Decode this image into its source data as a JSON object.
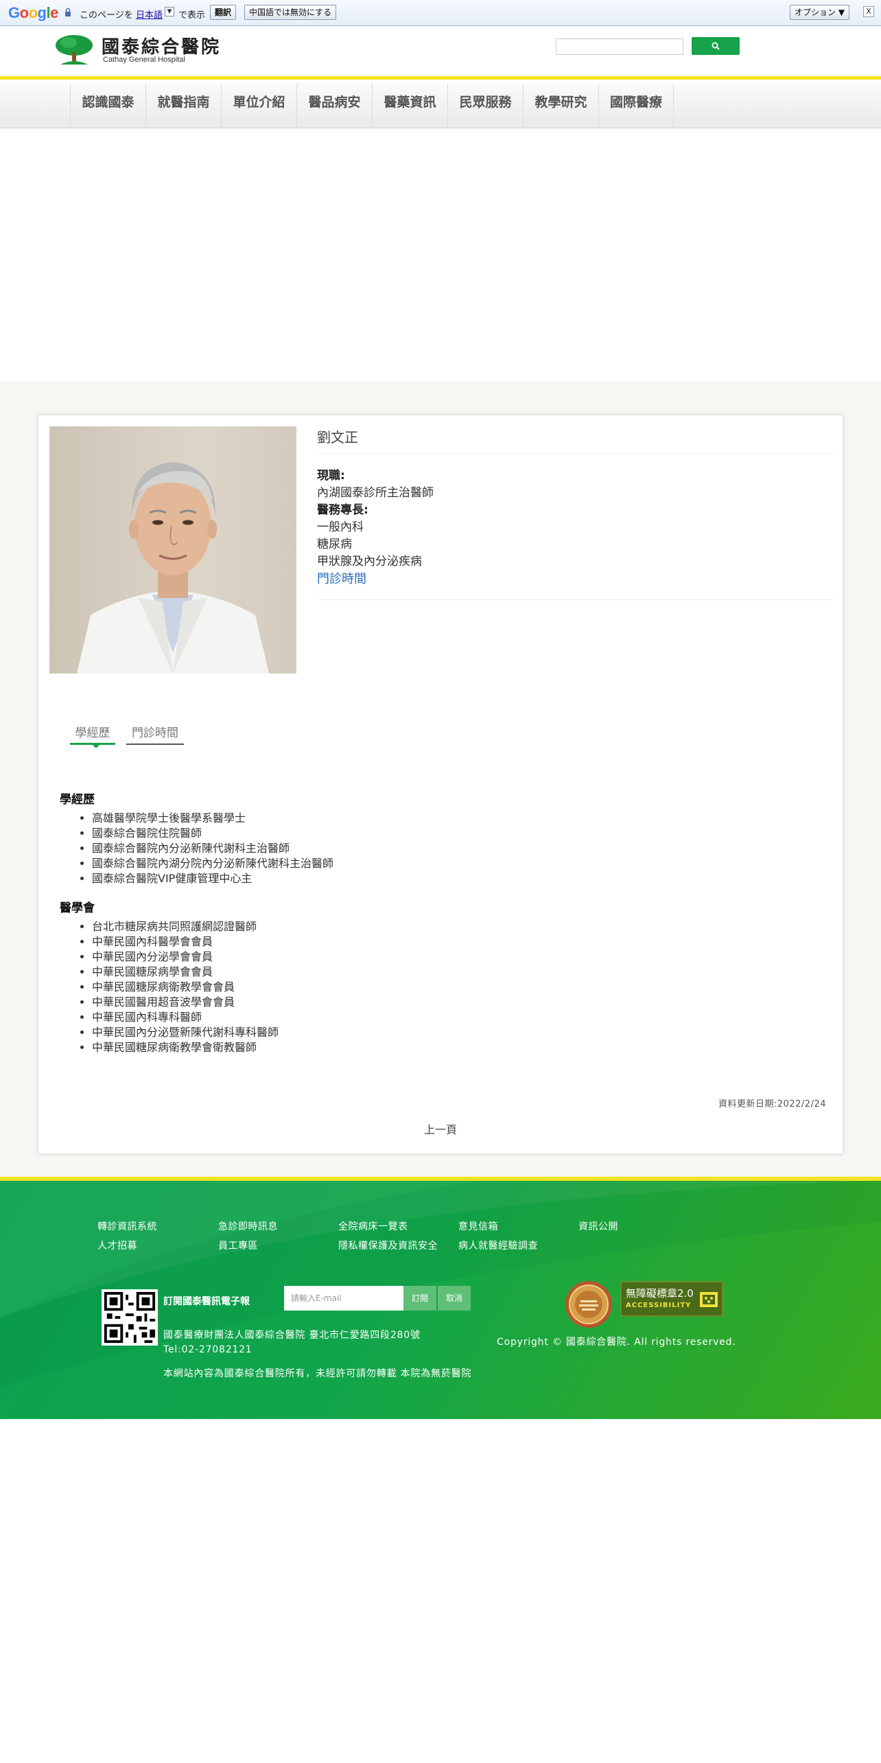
{
  "translate_bar": {
    "logo": "Google",
    "text_before": "このページを",
    "language": "日本語",
    "dropdown_glyph": "▼",
    "text_after": "で表示",
    "translate_button": "翻訳",
    "disable_button": "中国語では無効にする",
    "options_button": "オプション ▼",
    "close_button": "X"
  },
  "header": {
    "logo_zh": "國泰綜合醫院",
    "logo_en": "Cathay General Hospital",
    "search_placeholder": ""
  },
  "nav": [
    "認識國泰",
    "就醫指南",
    "單位介紹",
    "醫品病安",
    "醫藥資訊",
    "民眾服務",
    "教學研究",
    "國際醫療"
  ],
  "doctor": {
    "name": "劉文正",
    "position_label": "現職:",
    "position": "內湖國泰診所主治醫師",
    "specialty_label": "醫務專長:",
    "specialties": [
      "一般內科",
      "糖尿病",
      "甲狀腺及內分泌疾病"
    ],
    "schedule_link": "門診時間"
  },
  "tabs": [
    "學經歷",
    "門診時間"
  ],
  "education": {
    "title": "學經歷",
    "items": [
      "高雄醫學院學士後醫學系醫學士",
      "國泰綜合醫院住院醫師",
      "國泰綜合醫院內分泌新陳代謝科主治醫師",
      "國泰綜合醫院內湖分院內分泌新陳代謝科主治醫師",
      "國泰綜合醫院VIP健康管理中心主"
    ]
  },
  "societies": {
    "title": "醫學會",
    "items": [
      "台北市糖尿病共同照護網認證醫師",
      "中華民國內科醫學會會員",
      "中華民國內分泌學會會員",
      "中華民國糖尿病學會會員",
      "中華民國糖尿病衛教學會會員",
      "中華民國醫用超音波學會會員",
      "中華民國內科專科醫師",
      "中華民國內分泌暨新陳代謝科專科醫師",
      "中華民國糖尿病衛教學會衛教醫師"
    ]
  },
  "update_date": "資料更新日期:2022/2/24",
  "prev_page": "上一頁",
  "footer": {
    "links_row1": [
      "轉診資訊系統",
      "急診即時訊息",
      "全院病床一覽表",
      "意見信箱",
      "資訊公開"
    ],
    "links_row2": [
      "人才招募",
      "員工專區",
      "隱私權保護及資訊安全",
      "病人就醫經驗調查"
    ],
    "subscribe_title": "訂閱國泰醫訊電子報",
    "email_placeholder": "請輸入E-mail",
    "subscribe_button": "訂閱",
    "cancel_button": "取消",
    "address": "國泰醫療財團法人國泰綜合醫院  臺北市仁愛路四段280號",
    "tel": "Tel:02-27082121",
    "note": "本網站內容為國泰綜合醫院所有，未經許可請勿轉載  本院為無菸醫院",
    "accessibility_badge": "無障礙標章2.0",
    "accessibility_sub": "ACCESSIBILITY",
    "copyright": "Copyright © 國泰綜合醫院. All rights reserved."
  },
  "colors": {
    "brand_green": "#17a34a",
    "accent_yellow": "#f4e423",
    "link_blue": "#2a6ebb"
  }
}
